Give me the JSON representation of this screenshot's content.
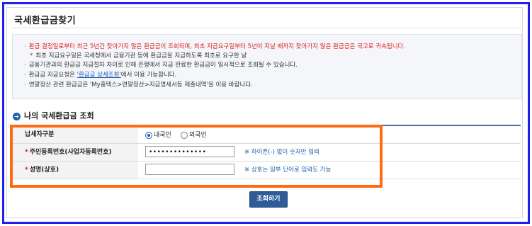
{
  "page": {
    "title": "국세환급금찾기"
  },
  "info": {
    "lines": [
      {
        "bullet": "·",
        "text": "환급 결정일로부터 최근 5년간 찾아가지 않은 환급금이 조회되며, 최초 지급요구일부터 5년이 지날 때까지 찾아가지 않은 환급금은 국고로 귀속됩니다.",
        "red": true
      },
      {
        "bullet": "*",
        "text": "최초 지급요구일은 국세청에서 금융기관 등에 환급금을 지급하도록 최초로 요구한 날",
        "red": false
      },
      {
        "bullet": "·",
        "text": "금융기관과의 환급금 지급절차 차이로 인해 은행에서 지급 완료한 환급금이 일시적으로 조회될 수 있습니다.",
        "red": false
      },
      {
        "bullet": "·",
        "text_before": "환급금 지급요청은 ",
        "link": "'환급금 상세조회'",
        "text_after": "에서 이용 가능합니다.",
        "red": false
      },
      {
        "bullet": "·",
        "text": "연말정산 관련 환급금은 'My홈택스>연말정산>지급명세서등 제출내역'을 이용 바랍니다.",
        "red": false
      }
    ]
  },
  "section": {
    "title": "나의 국세환급금 조회"
  },
  "form": {
    "taxpayer_type": {
      "label": "납세자구분",
      "options": [
        "내국인",
        "외국인"
      ],
      "selected": "내국인"
    },
    "id_number": {
      "required_mark": "*",
      "label": "주민등록번호(사업자등록번호)",
      "value": "••••••••••••••",
      "hint": "※ 하이픈(-) 없이 숫자만 입력"
    },
    "name": {
      "required_mark": "*",
      "label": "성명(상호)",
      "value": "",
      "hint": "※ 상호는 일부 단어로 입력도 가능"
    },
    "submit_label": "조회하기"
  },
  "colors": {
    "frame_border": "#1f1ff0",
    "highlight_box": "#ff6a12",
    "button": "#2d5c98",
    "warning_text": "#e02020"
  }
}
